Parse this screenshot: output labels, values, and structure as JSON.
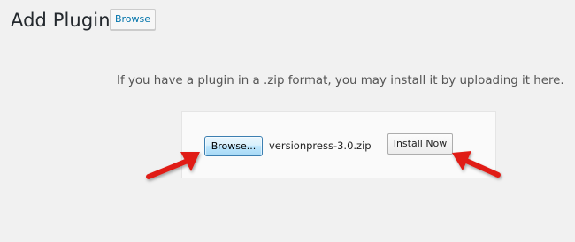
{
  "header": {
    "title": "Add Plugins",
    "browse_link": "Browse"
  },
  "main": {
    "help_text": "If you have a plugin in a .zip format, you may install it by uploading it here.",
    "upload": {
      "browse_button": "Browse...",
      "file_name": "versionpress-3.0.zip",
      "install_button": "Install Now"
    }
  },
  "annotations": {
    "arrow_color": "#e01e16",
    "icons": [
      "arrow-icon",
      "arrow-icon"
    ]
  }
}
